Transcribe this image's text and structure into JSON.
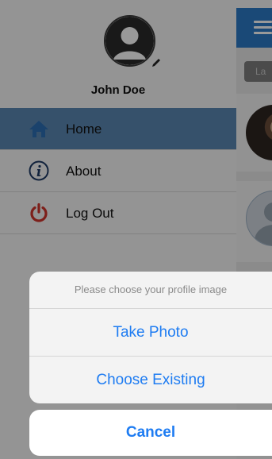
{
  "profile": {
    "name": "John Doe"
  },
  "menu": {
    "items": [
      {
        "label": "Home",
        "icon": "home-icon",
        "active": true
      },
      {
        "label": "About",
        "icon": "info-icon",
        "active": false
      },
      {
        "label": "Log Out",
        "icon": "power-icon",
        "active": false
      }
    ]
  },
  "main": {
    "search_text": "La"
  },
  "action_sheet": {
    "title": "Please choose your profile image",
    "options": [
      "Take Photo",
      "Choose Existing"
    ],
    "cancel_label": "Cancel"
  },
  "colors": {
    "accent": "#1e7cf2",
    "topbar": "#2c7bc6",
    "active_menu": "#5b87b3",
    "home_icon": "#2c6fb5",
    "info_icon": "#1f3b66",
    "power_icon": "#d0342c"
  }
}
